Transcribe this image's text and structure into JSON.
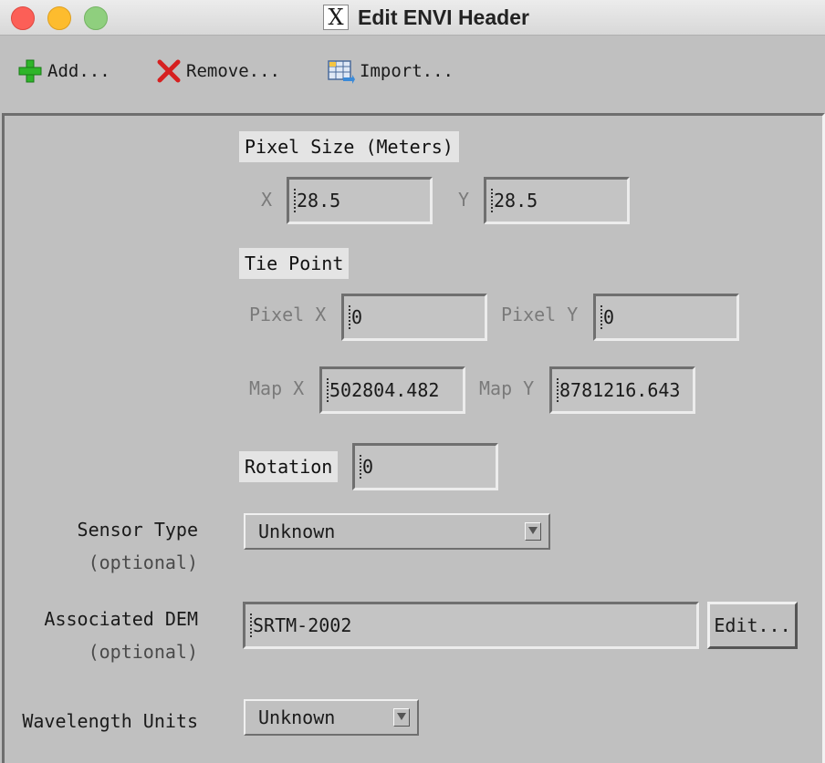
{
  "window": {
    "title": "Edit ENVI Header"
  },
  "toolbar": {
    "add_label": "Add...",
    "remove_label": "Remove...",
    "import_label": "Import..."
  },
  "pixel_size": {
    "section_label": "Pixel Size (Meters)",
    "x_label": "X",
    "x_value": "28.5",
    "y_label": "Y",
    "y_value": "28.5"
  },
  "tie_point": {
    "section_label": "Tie Point",
    "pixel_x_label": "Pixel X",
    "pixel_x_value": "0",
    "pixel_y_label": "Pixel Y",
    "pixel_y_value": "0",
    "map_x_label": "Map X",
    "map_x_value": "502804.482",
    "map_y_label": "Map Y",
    "map_y_value": "8781216.643"
  },
  "rotation": {
    "label": "Rotation",
    "value": "0"
  },
  "sensor_type": {
    "label": "Sensor Type",
    "optional": "(optional)",
    "selected": "Unknown"
  },
  "associated_dem": {
    "label": "Associated DEM",
    "optional": "(optional)",
    "value": "SRTM-2002",
    "edit_label": "Edit..."
  },
  "wavelength_units": {
    "label": "Wavelength Units",
    "selected": "Unknown"
  }
}
